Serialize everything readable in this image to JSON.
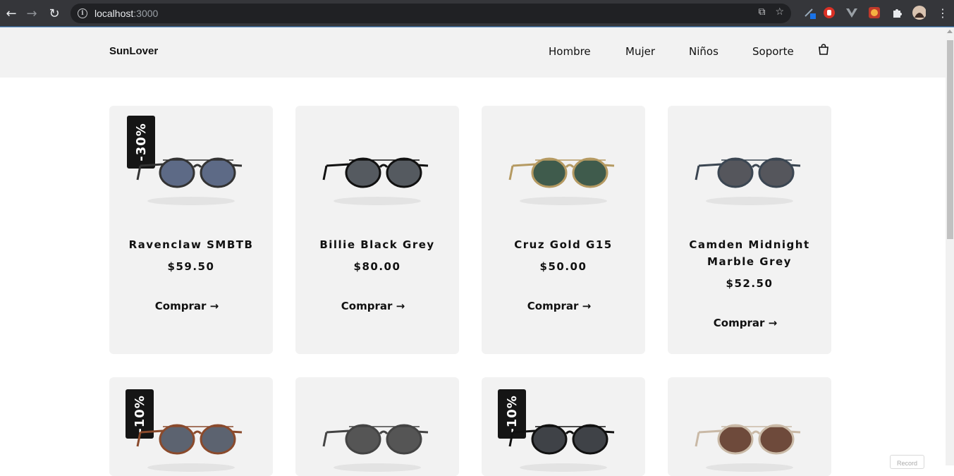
{
  "browser": {
    "url_host": "localhost",
    "url_port": ":3000"
  },
  "header": {
    "brand": "SunLover",
    "nav": [
      "Hombre",
      "Mujer",
      "Niños",
      "Soporte"
    ]
  },
  "products": [
    {
      "name": "Ravenclaw SMBTB",
      "price": "$59.50",
      "badge": "-30%",
      "buy": "Comprar →",
      "lens_color": "#5d6a86",
      "frame_color": "#333"
    },
    {
      "name": "Billie Black Grey",
      "price": "$80.00",
      "badge": "",
      "buy": "Comprar →",
      "lens_color": "#555a60",
      "frame_color": "#111"
    },
    {
      "name": "Cruz Gold G15",
      "price": "$50.00",
      "badge": "",
      "buy": "Comprar →",
      "lens_color": "#3f5b4c",
      "frame_color": "#b59a62"
    },
    {
      "name": "Camden Midnight Marble Grey",
      "price": "$52.50",
      "badge": "",
      "buy": "Comprar →",
      "lens_color": "#55565c",
      "frame_color": "#3b4652"
    },
    {
      "name": "",
      "price": "",
      "badge": "-10%",
      "buy": "",
      "lens_color": "#5c6370",
      "frame_color": "#8a4a2c"
    },
    {
      "name": "",
      "price": "",
      "badge": "",
      "buy": "",
      "lens_color": "#555",
      "frame_color": "#444"
    },
    {
      "name": "",
      "price": "",
      "badge": "-10%",
      "buy": "",
      "lens_color": "#3f4247",
      "frame_color": "#111"
    },
    {
      "name": "",
      "price": "",
      "badge": "",
      "buy": "",
      "lens_color": "#6e4a3b",
      "frame_color": "#c9b9a6"
    }
  ],
  "record_label": "Record"
}
